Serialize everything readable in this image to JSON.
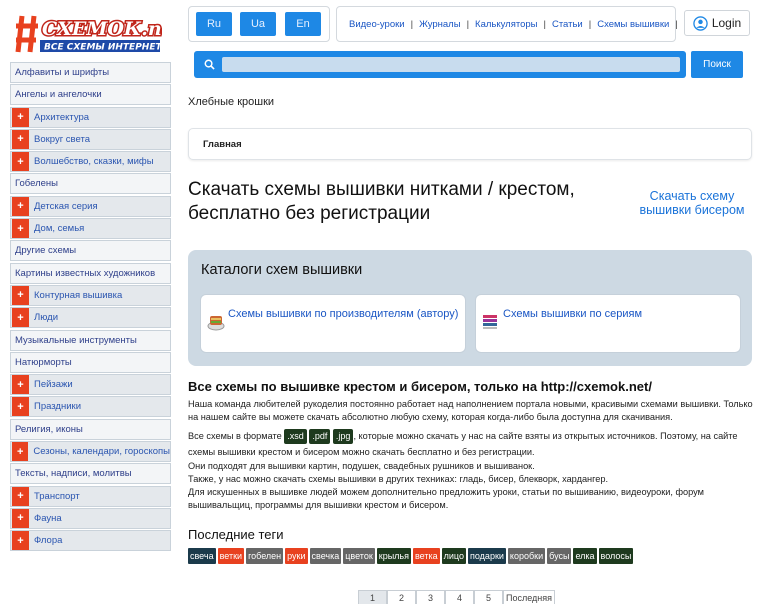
{
  "logo": {
    "text": "СХЕМОК.net",
    "subtext": "ВСЕ СХЕМЫ ИНТЕРНЕТА"
  },
  "languages": [
    "Ru",
    "Ua",
    "En"
  ],
  "topnav": [
    "Видео-уроки",
    "Журналы",
    "Калькуляторы",
    "Статьи",
    "Схемы вышивки"
  ],
  "login_label": "Login",
  "search": {
    "placeholder": "",
    "button_label": "Поиск"
  },
  "sidebar": {
    "items": [
      {
        "label": "Алфавиты и шрифты",
        "expandable": false
      },
      {
        "label": "Ангелы и ангелочки",
        "expandable": false
      },
      {
        "label": "Архитектура",
        "expandable": true
      },
      {
        "label": "Вокруг света",
        "expandable": true
      },
      {
        "label": "Волшебство, сказки, мифы",
        "expandable": true
      },
      {
        "label": "Гобелены",
        "expandable": false
      },
      {
        "label": "Детская серия",
        "expandable": true
      },
      {
        "label": "Дом, семья",
        "expandable": true
      },
      {
        "label": "Другие схемы",
        "expandable": false
      },
      {
        "label": "Картины известных художников",
        "expandable": false
      },
      {
        "label": "Контурная вышивка",
        "expandable": true
      },
      {
        "label": "Люди",
        "expandable": true
      },
      {
        "label": "Музыкальные инструменты",
        "expandable": false
      },
      {
        "label": "Натюрморты",
        "expandable": false
      },
      {
        "label": "Пейзажи",
        "expandable": true
      },
      {
        "label": "Праздники",
        "expandable": true
      },
      {
        "label": "Религия, иконы",
        "expandable": false
      },
      {
        "label": "Сезоны, календари, гороскопы",
        "expandable": true
      },
      {
        "label": "Тексты, надписи, молитвы",
        "expandable": false
      },
      {
        "label": "Транспорт",
        "expandable": true
      },
      {
        "label": "Фауна",
        "expandable": true
      },
      {
        "label": "Флора",
        "expandable": true
      }
    ]
  },
  "breadcrumbs": {
    "title": "Хлебные крошки",
    "items": [
      "Главная"
    ]
  },
  "page_title": "Скачать схемы вышивки нитками / крестом, бесплатно без регистрации",
  "bead_link": "Скачать схему вышивки бисером",
  "catalogs": {
    "title": "Каталоги схем вышивки",
    "cards": [
      {
        "label": "Схемы вышивки по производителям (автору)",
        "icon": "thread-spool-icon"
      },
      {
        "label": "Схемы вышивки по сериям",
        "icon": "thread-stack-icon"
      }
    ]
  },
  "about": {
    "title": "Все схемы по вышивке крестом и бисером, только на http://cxemok.net/",
    "p1": "Наша команда любителей рукоделия постоянно работает над наполнением портала новыми, красивыми схемами вышивки. Только на нашем сайте вы можете скачать абсолютно любую схему, которая когда-либо была доступна для скачивания.",
    "p2_pre": "Все схемы в формате ",
    "formats": [
      ".xsd",
      ".pdf",
      ".jpg"
    ],
    "p2_post": ", которые можно скачать у нас на сайте взяты из открытых источников. Поэтому, на сайте схемы вышивки крестом и бисером можно скачать бесплатно и без регистрации.",
    "p3": "Они подходят для вышивки картин, подушек, свадебных рушников и вышиванок.",
    "p4": "Также, у нас можно скачать схемы вышивки в других техниках: гладь, бисер, блекворк, хардангер.",
    "p5": "Для искушенных в вышивке людей можем дополнительно предложить уроки, статьи по вышиванию, видеоуроки, форум вышивальщиц, программы для вышивки крестом и бисером."
  },
  "tags": {
    "title": "Последние теги",
    "items": [
      {
        "label": "свеча",
        "color": "#1b3a4b"
      },
      {
        "label": "ветки",
        "color": "#e8411f"
      },
      {
        "label": "гобелен",
        "color": "#666666"
      },
      {
        "label": "руки",
        "color": "#e8411f"
      },
      {
        "label": "свечка",
        "color": "#666666"
      },
      {
        "label": "цветок",
        "color": "#666666"
      },
      {
        "label": "крылья",
        "color": "#1e3a1e"
      },
      {
        "label": "ветка",
        "color": "#e8411f"
      },
      {
        "label": "лицо",
        "color": "#1e3a1e"
      },
      {
        "label": "подарки",
        "color": "#1b3a4b"
      },
      {
        "label": "коробки",
        "color": "#666666"
      },
      {
        "label": "бусы",
        "color": "#666666"
      },
      {
        "label": "елка",
        "color": "#1e3a1e"
      },
      {
        "label": "волосы",
        "color": "#1e3a1e"
      }
    ]
  },
  "pager": [
    "1",
    "2",
    "3",
    "4",
    "5",
    "Последняя"
  ],
  "colors": {
    "accent": "#1e88e5",
    "plus": "#e8411f",
    "link": "#1a56c4"
  }
}
